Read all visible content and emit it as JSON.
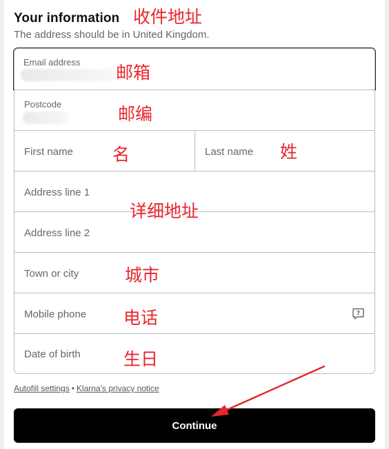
{
  "header": {
    "title": "Your information",
    "subtitle": "The address should be in United Kingdom."
  },
  "form": {
    "email": {
      "label": "Email address"
    },
    "postcode": {
      "label": "Postcode"
    },
    "first_name": {
      "placeholder": "First name"
    },
    "last_name": {
      "placeholder": "Last name"
    },
    "address_line1": {
      "placeholder": "Address line 1"
    },
    "address_line2": {
      "placeholder": "Address line 2"
    },
    "town": {
      "placeholder": "Town or city"
    },
    "mobile": {
      "placeholder": "Mobile phone",
      "help_icon": "question-bubble-icon"
    },
    "dob": {
      "placeholder": "Date of birth"
    }
  },
  "links": {
    "autofill": "Autofill settings",
    "separator": "•",
    "privacy": "Klarna's privacy notice"
  },
  "continue_label": "Continue",
  "annotations": {
    "header": "收件地址",
    "email": "邮箱",
    "postcode": "邮编",
    "first_name": "名",
    "last_name": "姓",
    "address": "详细地址",
    "town": "城市",
    "mobile": "电话",
    "dob": "生日"
  },
  "colors": {
    "annotation": "#e8262d",
    "button": "#000000",
    "border": "#bdbdbd"
  }
}
